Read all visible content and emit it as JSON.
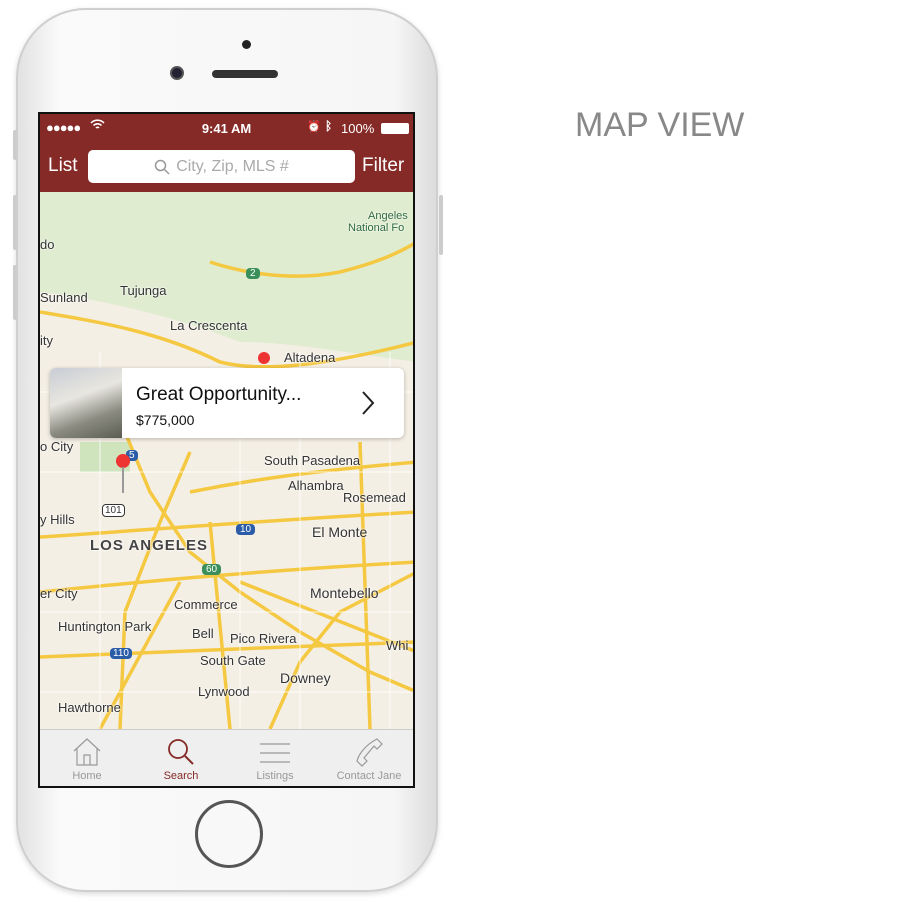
{
  "page_title": "MAP VIEW",
  "status_bar": {
    "time": "9:41 AM",
    "battery": "100%"
  },
  "nav": {
    "list_label": "List",
    "search_placeholder": "City, Zip, MLS #",
    "filter_label": "Filter"
  },
  "map": {
    "labels": [
      "Angeles",
      "National Fo",
      "do",
      "Tujunga",
      "Sunland",
      "La Crescenta",
      "ity",
      "Altadena",
      "o City",
      "South Pasadena",
      "Alhambra",
      "Rosemead",
      "y Hills",
      "El Monte",
      "LOS ANGELES",
      "er City",
      "Montebello",
      "Commerce",
      "Huntington Park",
      "Bell",
      "Pico Rivera",
      "Whi",
      "South Gate",
      "Downey",
      "Lynwood",
      "Hawthorne"
    ],
    "shields": [
      "2",
      "5",
      "101",
      "10",
      "60",
      "110"
    ]
  },
  "callout": {
    "title": "Great Opportunity...",
    "price": "$775,000"
  },
  "tabs": [
    {
      "label": "Home",
      "icon": "home-icon"
    },
    {
      "label": "Search",
      "icon": "search-icon",
      "active": true
    },
    {
      "label": "Listings",
      "icon": "list-icon"
    },
    {
      "label": "Contact Jane",
      "icon": "phone-icon"
    }
  ],
  "colors": {
    "brand": "#852a27",
    "active_tab": "#852a27",
    "inactive_tab": "#999999"
  }
}
